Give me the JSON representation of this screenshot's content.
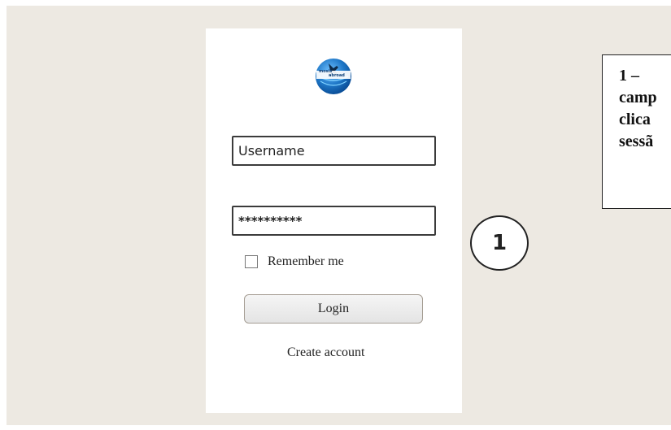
{
  "login_form": {
    "logo_text_line1": "mosis",
    "logo_text_line2": "abroad",
    "username_placeholder": "Username",
    "password_value": "**********",
    "remember_label": "Remember me",
    "login_label": "Login",
    "create_account_label": "Create account"
  },
  "annotation": {
    "callout_number": "1",
    "note_lines": [
      "1 –",
      "camp",
      "clica",
      "sessã"
    ]
  },
  "colors": {
    "background": "#ede9e2",
    "panel": "#ffffff",
    "logo_blue": "#1f78c8"
  }
}
